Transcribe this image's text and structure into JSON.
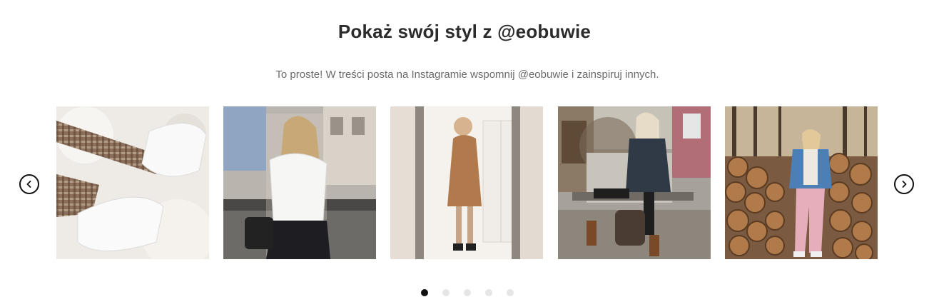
{
  "header": {
    "title": "Pokaż swój styl z @eobuwie",
    "subtitle": "To proste! W treści posta na Instagramie wspomnij @eobuwie i zainspiruj innych."
  },
  "carousel": {
    "prev_icon": "chevron-left-icon",
    "next_icon": "chevron-right-icon",
    "photos": [
      {
        "subject": "white-sneakers-on-fur-rug"
      },
      {
        "subject": "woman-in-white-shirt-sitting-outdoors"
      },
      {
        "subject": "mirror-selfie-brown-coat"
      },
      {
        "subject": "woman-in-dark-coat-with-backpack-on-bench"
      },
      {
        "subject": "woman-in-denim-jacket-by-log-pile"
      }
    ],
    "dots": {
      "count": 5,
      "active_index": 0
    }
  }
}
